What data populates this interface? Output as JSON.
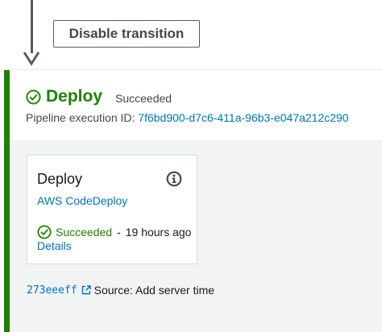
{
  "transition": {
    "disable_button_label": "Disable transition"
  },
  "stage": {
    "name": "Deploy",
    "status": "Succeeded",
    "execution_label": "Pipeline execution ID:",
    "execution_id": "7f6bd900-d7c6-411a-96b3-e047a212c290"
  },
  "action": {
    "name": "Deploy",
    "provider": "AWS CodeDeploy",
    "status": "Succeeded",
    "separator": "-",
    "time_ago": "19 hours ago",
    "details_label": "Details"
  },
  "source": {
    "commit_id": "273eeeff",
    "message": "Source: Add server time"
  },
  "colors": {
    "success": "#1d8102",
    "link": "#0073bb",
    "accent_bar": "#1d8102"
  },
  "icons": {
    "stage_status": "check-circle-icon",
    "action_info": "info-icon",
    "action_status": "check-circle-icon",
    "commit_link": "external-link-icon",
    "transition": "arrow-down-icon"
  }
}
